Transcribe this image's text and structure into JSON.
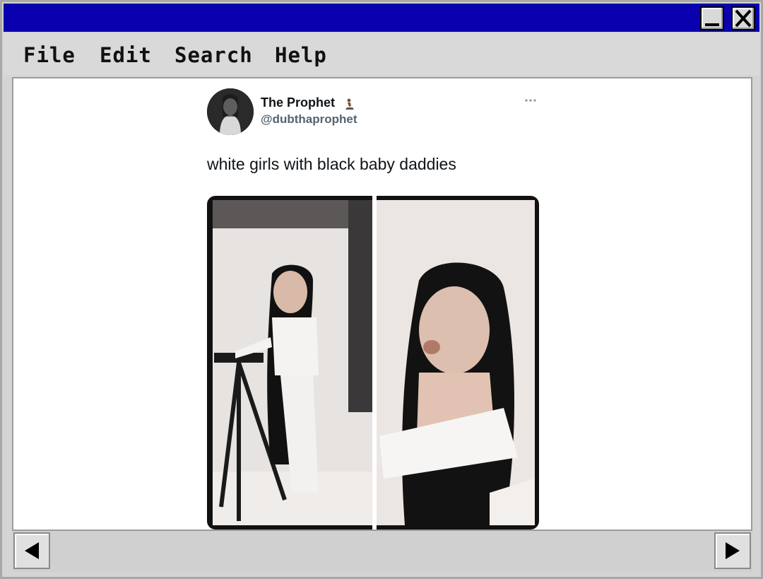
{
  "window": {
    "minimize_icon": "minimize-icon",
    "close_icon": "close-icon",
    "title_color": "#0b00b0"
  },
  "menu": {
    "file": "File",
    "edit": "Edit",
    "search": "Search",
    "help": "Help"
  },
  "tweet": {
    "display_name": "The Prophet",
    "badge_icon": "praying-figure-icon",
    "handle": "@dubthaprophet",
    "more_icon": "more-dots-icon",
    "text": "white girls with black baby daddies",
    "media_icon": "photo-collage"
  },
  "scrollbar": {
    "left_icon": "arrow-left-icon",
    "right_icon": "arrow-right-icon"
  }
}
